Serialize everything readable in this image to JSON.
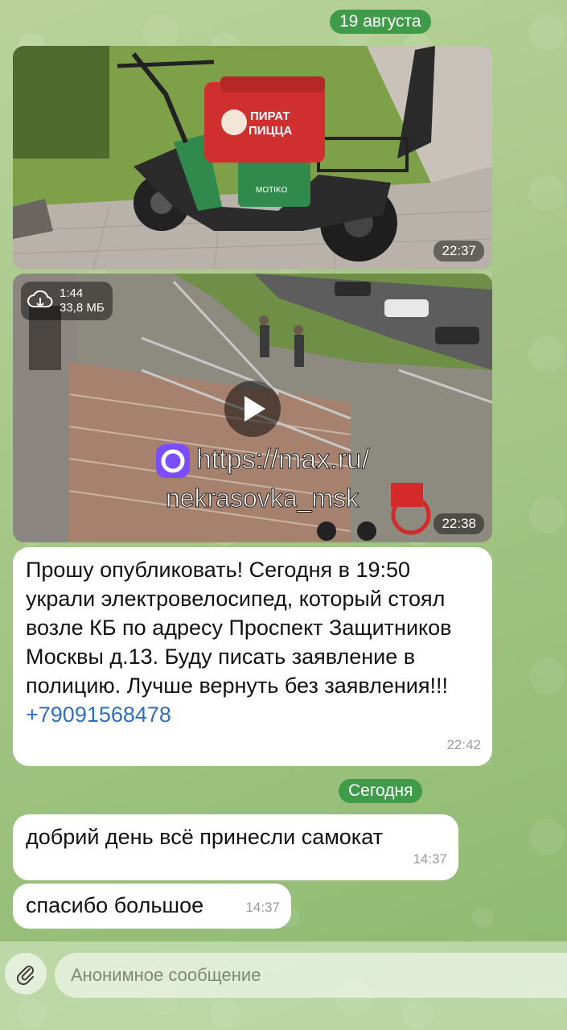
{
  "date_dividers": {
    "first": "19 августа",
    "second": "Сегодня"
  },
  "messages": {
    "photo": {
      "time": "22:37"
    },
    "video": {
      "duration": "1:44",
      "size": "33,8 МБ",
      "time": "22:38",
      "overlay_url_line1": "https://max.ru/",
      "overlay_url_line2": "nekrasovka_msk",
      "box_text_line1": "ПИРАТ",
      "box_text_line2": "ПИЦЦА",
      "brand_text": "MOTIKO"
    },
    "text1": {
      "body": "Прошу опубликовать! Сегодня в 19:50 украли электровелосипед, который стоял возле КБ по адресу Проспект Защитников Москвы д.13. Буду писать заявление в полицию. Лучше вернуть без заявления!!! ",
      "phone": "+79091568478",
      "time": "22:42"
    },
    "text2": {
      "body": "добрий день всё принесли самокат",
      "time": "14:37"
    },
    "text3": {
      "body": "спасибо большое",
      "time": "14:37"
    }
  },
  "composer": {
    "placeholder": "Анонимное сообщение",
    "attach_icon": "paperclip-icon"
  },
  "colors": {
    "date_pill": "#3f9b4a",
    "link": "#2a6fc7",
    "bubble": "#ffffff"
  }
}
